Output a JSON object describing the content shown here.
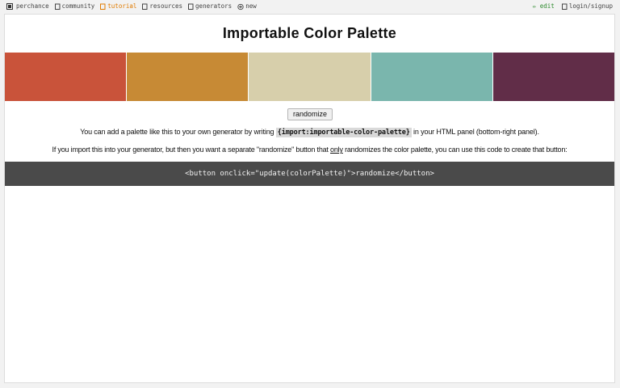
{
  "nav": {
    "brand": "perchance",
    "items_left": [
      {
        "label": "community",
        "icon": "chat-icon"
      },
      {
        "label": "tutorial",
        "icon": "book-icon"
      },
      {
        "label": "resources",
        "icon": "folder-icon"
      },
      {
        "label": "generators",
        "icon": "list-icon"
      },
      {
        "label": "new",
        "icon": "plus-circle-icon"
      }
    ],
    "edit_label": "✏ edit",
    "login_label": "login/signup"
  },
  "page": {
    "title": "Importable Color Palette",
    "palette": [
      "#c9533a",
      "#c78a35",
      "#d7cfab",
      "#7ab6ad",
      "#612d48"
    ],
    "randomize_label": "randomize",
    "line1_before": "You can add a palette like this to your own generator by writing ",
    "line1_code": "{import:importable-color-palette}",
    "line1_after": " in your HTML panel (bottom-right panel).",
    "line2_before": "If you import this into your generator, but then you want a separate \"randomize\" button that ",
    "line2_underlined": "only",
    "line2_after": " randomizes the color palette, you can use this code to create that button:",
    "code_snippet": "<button onclick=\"update(colorPalette)\">randomize</button>"
  },
  "colors": {
    "active_nav": "#e07b00",
    "edit_link": "#2e8b2e",
    "code_bar_bg": "#4a4a4a"
  }
}
